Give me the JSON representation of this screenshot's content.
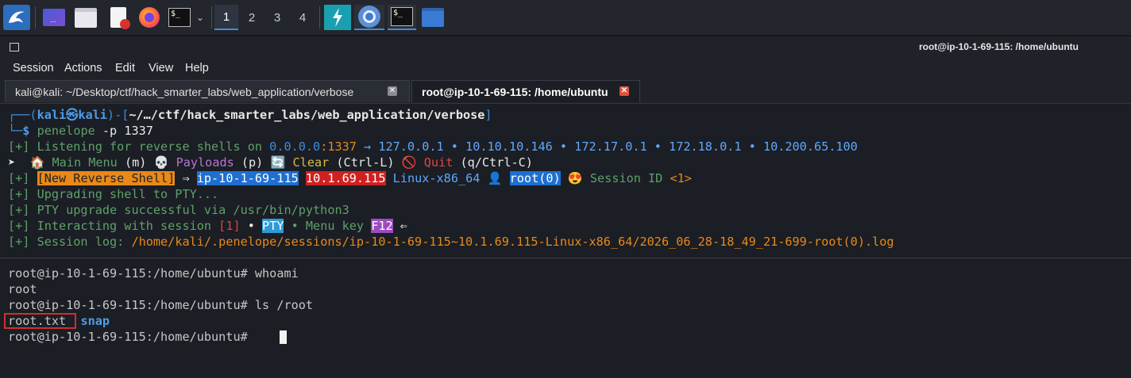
{
  "taskbar": {
    "workspaces": [
      "1",
      "2",
      "3",
      "4"
    ],
    "active_workspace": "1",
    "icons": [
      "kali-menu-icon",
      "desktop-icon",
      "files-icon",
      "text-editor-icon",
      "firefox-icon",
      "terminal-icon",
      "chevron-down-icon",
      "burpsuite-icon",
      "chromium-icon",
      "terminal-window-icon",
      "folder-window-icon"
    ]
  },
  "window": {
    "title": "root@ip-10-1-69-115: /home/ubuntu"
  },
  "menubar": [
    "Session",
    "Actions",
    "Edit",
    "View",
    "Help"
  ],
  "tabs": [
    {
      "label": "kali@kali: ~/Desktop/ctf/hack_smarter_labs/web_application/verbose",
      "active": false
    },
    {
      "label": "root@ip-10-1-69-115: /home/ubuntu",
      "active": true
    }
  ],
  "terminal": {
    "prompt": {
      "open": "┌──(",
      "user": "kali",
      "at": "㉿",
      "host": "kali",
      "mid": ")-[",
      "path": "~/…/ctf/hack_smarter_labs/web_application/verbose",
      "close": "]",
      "corner": "└─",
      "dollar": "$",
      "cmd_name": "penelope",
      "cmd_args": " -p 1337"
    },
    "listening": {
      "prefix": "[+] Listening for reverse shells on ",
      "addr": "0.0.0.0",
      "port": ":1337",
      "arrow": " → ",
      "ips": "127.0.0.1 • 10.10.10.146 • 172.17.0.1 • 172.18.0.1 • 10.200.65.100"
    },
    "menu": {
      "caret": "➤ ",
      "home_icon": "🏠",
      "main_menu": " Main Menu",
      "main_key": " (m) ",
      "skull_icon": "💀",
      "payloads": " Payloads",
      "payloads_key": " (p) ",
      "clear_icon": "🔄",
      "clear": " Clear",
      "clear_key": " (Ctrl-L) ",
      "quit_icon": "🚫",
      "quit": " Quit",
      "quit_key": " (q/Ctrl-C)"
    },
    "new_shell": {
      "prefix": "[+] ",
      "badge": "[New Reverse Shell]",
      "arrow": " ⇒ ",
      "host": "ip-10-1-69-115",
      "ip": "10.1.69.115",
      "os": "Linux-x86_64",
      "user_icon": "👤",
      "user": "root(0)",
      "face_icon": "😍",
      "session_label": "Session ID",
      "session_id": "<1>"
    },
    "upgrading": "[+] Upgrading shell to PTY...",
    "pty_success": "[+] PTY upgrade successful via /usr/bin/python3",
    "interacting": {
      "prefix": "[+] Interacting with session ",
      "session": "[1]",
      "bullet1": " • ",
      "pty": "PTY",
      "menu_key_label": " • Menu key ",
      "key": "F12",
      "arrow": " ⇐"
    },
    "session_log": {
      "prefix": "[+] Session log: ",
      "path": "/home/kali/.penelope/sessions/ip-10-1-69-115~10.1.69.115-Linux-x86_64/2026_06_28-18_49_21-699-root(0).log"
    },
    "lines": [
      "root@ip-10-1-69-115:/home/ubuntu# whoami",
      "root",
      "root@ip-10-1-69-115:/home/ubuntu# ls /root"
    ],
    "ls_file": "root.txt",
    "ls_dir": "snap",
    "final_prompt": "root@ip-10-1-69-115:/home/ubuntu# "
  },
  "colors": {
    "accent": "#3b8ddd",
    "prompt_green": "#5fa06b",
    "warning_orange": "#e8891a",
    "highlight_box": "#d22f2f"
  }
}
